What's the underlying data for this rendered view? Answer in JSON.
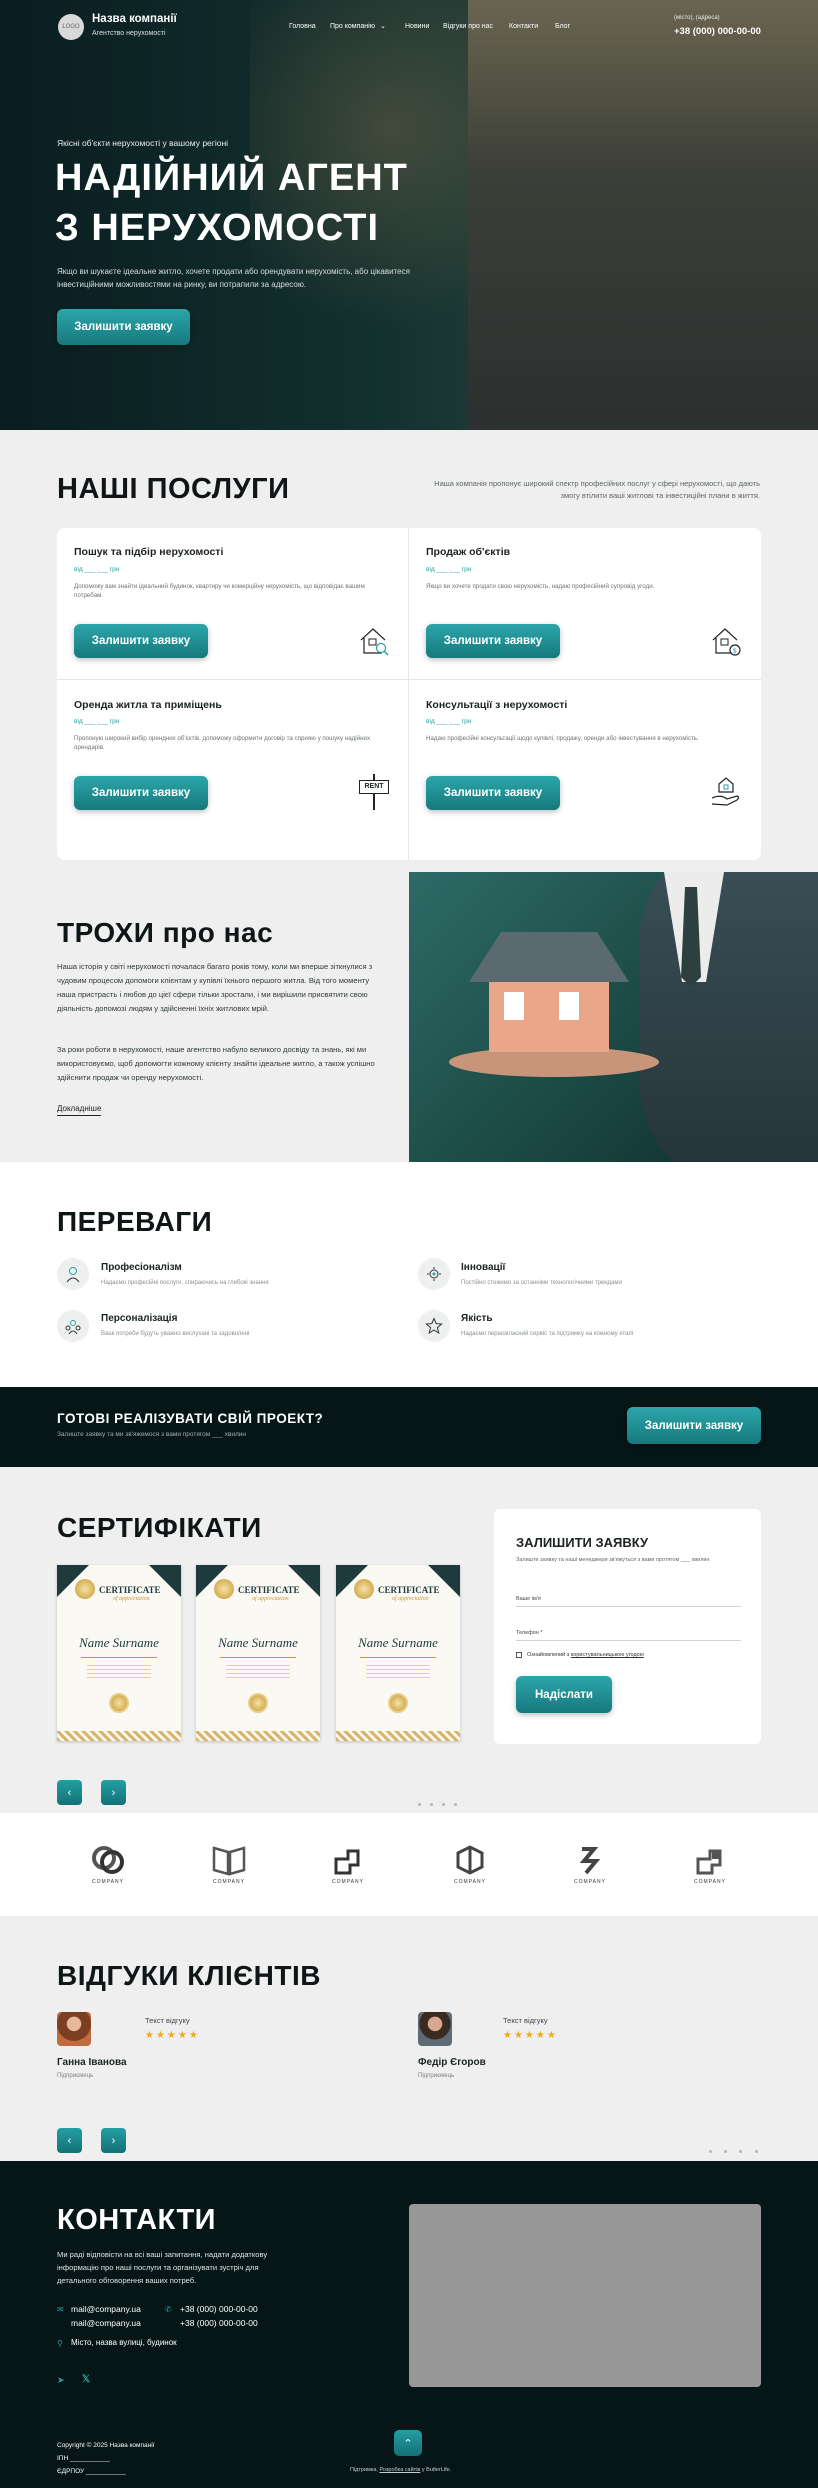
{
  "header": {
    "logo": "LOGO",
    "company_name": "Назва компанії",
    "company_sub": "Агентство нерухомості",
    "nav": [
      "Головна",
      "Про компанію",
      "Новини",
      "Відгуки про нас",
      "Контакти",
      "Блог"
    ],
    "contact_small": "(місто), (адреса)",
    "phone": "+38 (000) 000-00-00"
  },
  "hero": {
    "eyebrow": "Якісні об'єкти нерухомості у вашому регіоні",
    "title1": "НАДІЙНИЙ АГЕНТ",
    "title2": "З НЕРУХОМОСТІ",
    "desc": "Якщо ви шукаєте ідеальне житло, хочете продати або орендувати нерухомість, або цікавитеся інвестиційними можливостями на ринку, ви потрапили за адресою.",
    "cta": "Залишити заявку"
  },
  "services": {
    "title": "НАШІ ПОСЛУГИ",
    "intro": "Наша компанія пропонує широкий спектр професійних послуг у сфері нерухомості, що дають змогу втілити ваші житлові та інвестиційні плани в життя.",
    "items": [
      {
        "title": "Пошук та підбір нерухомості",
        "price": "від ___ ___ грн",
        "desc": "Допоможу вам знайти ідеальний будинок, квартиру чи комерційну нерухомість, що відповідає вашим потребам.",
        "button": "Залишити заявку",
        "icon": "house-search-icon"
      },
      {
        "title": "Продаж об'єктів",
        "price": "від ___ ___ грн",
        "desc": "Якщо ви хочете продати свою нерухомість, надаю професійний супровід угоди.",
        "button": "Залишити заявку",
        "icon": "house-sale-icon"
      },
      {
        "title": "Оренда житла та приміщень",
        "price": "від ___ ___ грн",
        "desc": "Пропоную широкий вибір орендних об'єктів, допоможу оформити договір та сприяю у пошуку надійних орендарів.",
        "button": "Залишити заявку",
        "icon": "rent-sign-icon",
        "icon_text": "RENT"
      },
      {
        "title": "Консультації з нерухомості",
        "price": "від ___ ___ грн",
        "desc": "Надаю професійні консультації щодо купівлі, продажу, оренди або інвестування в нерухомість.",
        "button": "Залишити заявку",
        "icon": "house-hand-icon"
      }
    ]
  },
  "about": {
    "title": "ТРОХИ про нас",
    "p1": "Наша історія у світі нерухомості почалася багато років тому, коли ми вперше зіткнулися з чудовим процесом допомоги клієнтам у купівлі їхнього першого житла. Від того моменту наша пристрасть і любов до цієї сфери тільки зростали, і ми вирішили присвятити свою діяльність допомозі людям у здійсненні їхніх житлових мрій.",
    "p2": "За роки роботи в нерухомості, наше агентство набуло великого досвіду та знань, які ми використовуємо, щоб допомогти кожному клієнту знайти ідеальне житло, а також успішно здійснити продаж чи оренду нерухомості.",
    "link": "Докладніше"
  },
  "advantages": {
    "title": "ПЕРЕВАГИ",
    "items": [
      {
        "title": "Професіоналізм",
        "desc": "Надаємо професійні послуги, спираючись на глибокі знання",
        "icon": "professional-icon"
      },
      {
        "title": "Інновації",
        "desc": "Постійно стежимо за останніми технологічними трендами",
        "icon": "innovation-icon"
      },
      {
        "title": "Персоналізація",
        "desc": "Ваші потреби будуть уважно вислухані та задоволені",
        "icon": "personalization-icon"
      },
      {
        "title": "Якість",
        "desc": "Надаємо першокласний сервіс та підтримку на кожному етапі",
        "icon": "star-icon"
      }
    ]
  },
  "cta_band": {
    "title": "ГОТОВІ РЕАЛІЗУВАТИ СВІЙ ПРОЕКТ?",
    "sub": "Залиште заявку та ми зв'яжемося з вами протягом ___ хвилин",
    "button": "Залишити заявку"
  },
  "certificates": {
    "title": "СЕРТИФІКАТИ",
    "cert_heading": "CERTIFICATE",
    "cert_sub": "of appreciation",
    "cert_name": "Name Surname",
    "count": 3,
    "prev": "‹",
    "next": "›"
  },
  "form": {
    "title": "ЗАЛИШИТИ ЗАЯВКУ",
    "sub": "Залиште заявку та наші менеджери зв'яжуться з вами протягом ___ хвилин",
    "name_label": "Ваше ім'я",
    "phone_label": "Телефон *",
    "consent_pre": "Ознайомлений з ",
    "consent_link": "користувальницькою угодою",
    "submit": "Надіслати"
  },
  "partners": [
    {
      "cap": "COMPANY",
      "icon": "partner-logo-1-icon"
    },
    {
      "cap": "COMPANY",
      "icon": "partner-logo-2-icon"
    },
    {
      "cap": "COMPANY",
      "icon": "partner-logo-3-icon"
    },
    {
      "cap": "COMPANY",
      "icon": "partner-logo-4-icon"
    },
    {
      "cap": "COMPANY",
      "icon": "partner-logo-5-icon"
    },
    {
      "cap": "COMPANY",
      "icon": "partner-logo-6-icon"
    }
  ],
  "reviews": {
    "title": "ВІДГУКИ КЛІЄНТІВ",
    "items": [
      {
        "name": "Ганна Іванова",
        "role": "Підприємець",
        "text": "Текст відгуку",
        "stars": "★★★★★"
      },
      {
        "name": "Федір Єгоров",
        "role": "Підприємець",
        "text": "Текст відгуку",
        "stars": "★★★★★"
      }
    ]
  },
  "contacts": {
    "title": "КОНТАКТИ",
    "desc": "Ми раді відповісти на всі ваші запитання, надати додаткову інформацію про наші послуги та організувати зустріч для детального обговорення ваших потреб.",
    "email1": "mail@company.ua",
    "email2": "mail@company.ua",
    "phone1": "+38 (000) 000-00-00",
    "phone2": "+38 (000) 000-00-00",
    "address": "Місто, назва вулиці, будинок"
  },
  "footer": {
    "copyright": "Copyright © 2025 Назва компанії",
    "ipn": "ІПН ___________",
    "edrpou": "ЄДРПОУ ___________",
    "credit_pre": "Підтримка, ",
    "credit_link": "Розробка сайтів",
    "credit_post": " у ButterLife.",
    "up": "⌃"
  },
  "colors": {
    "accent": "#1f9599",
    "dark": "#061516",
    "light_bg": "#efefef"
  }
}
